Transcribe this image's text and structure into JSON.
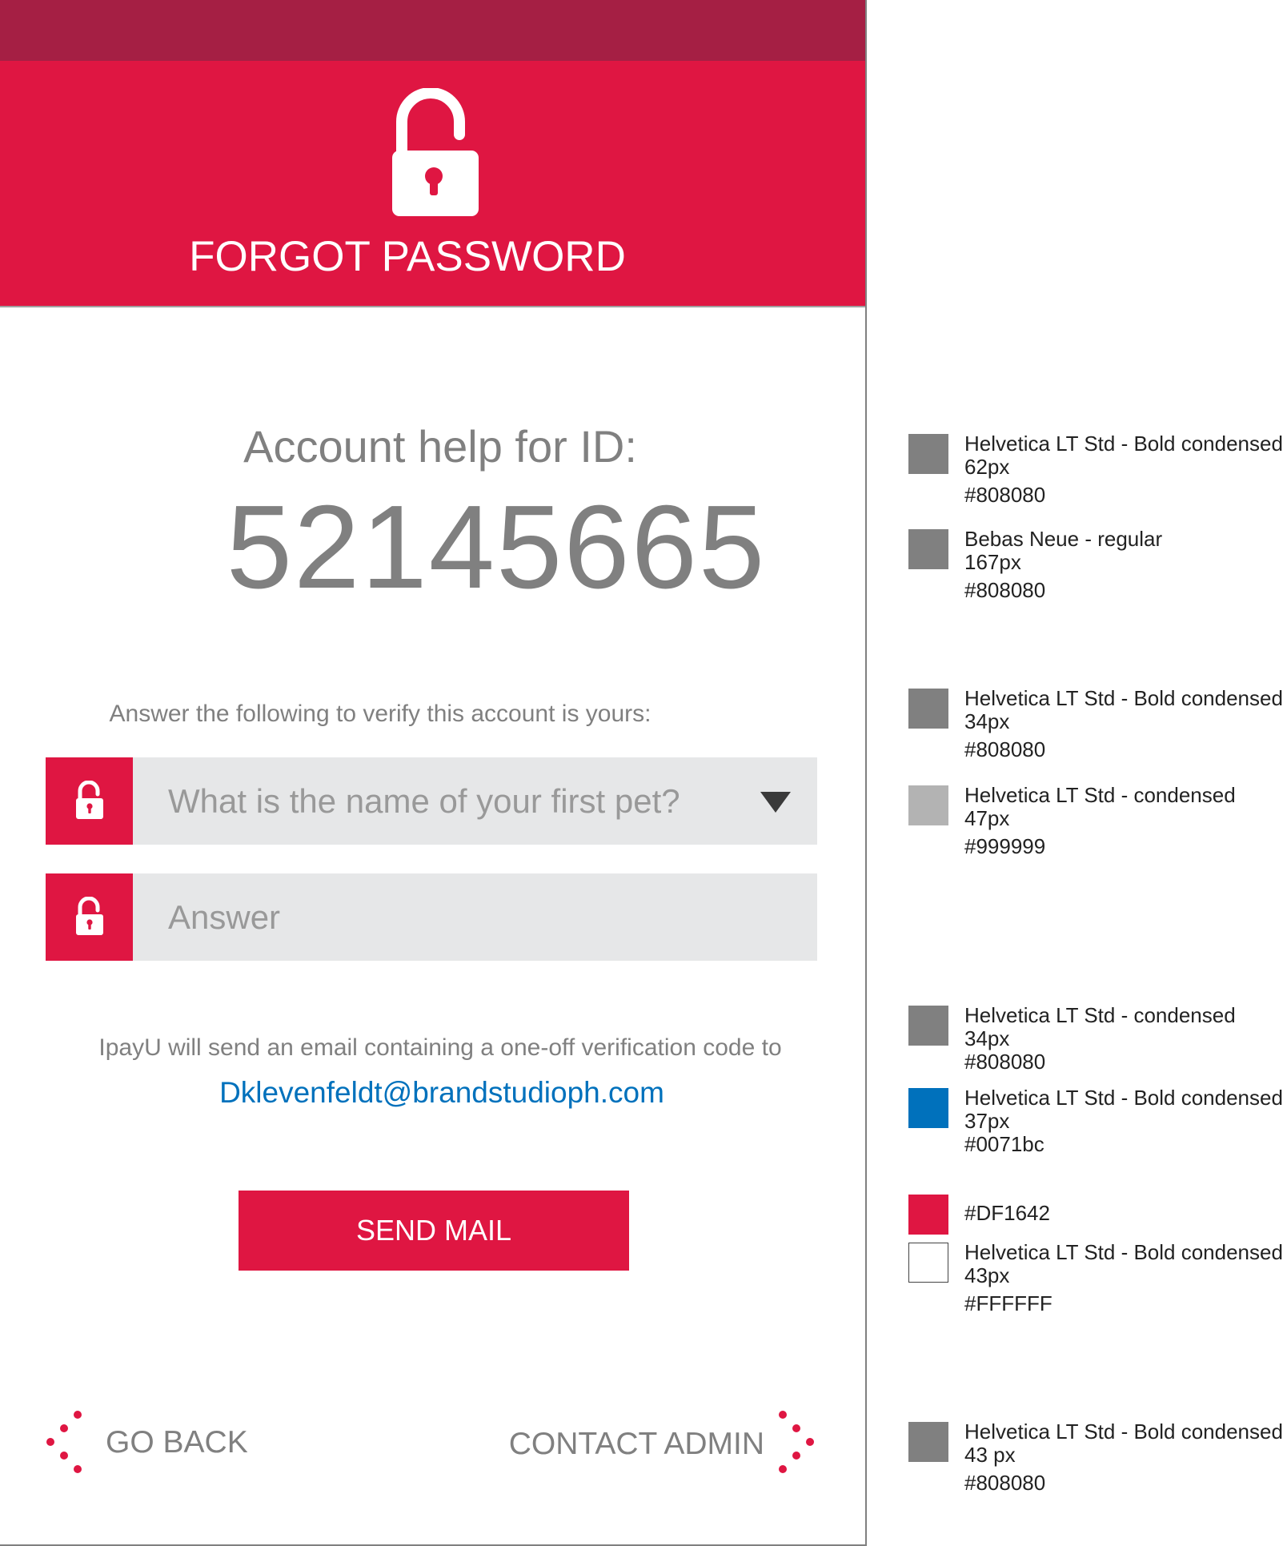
{
  "header": {
    "title": "FORGOT PASSWORD",
    "icon": "unlocked-padlock-icon"
  },
  "account": {
    "label": "Account help for ID:",
    "id": "52145665"
  },
  "form": {
    "instruction": "Answer the following to verify this account is yours:",
    "question": {
      "value": "What is the name of your first pet?",
      "icon": "unlocked-padlock-icon",
      "dropdown_icon": "caret-down-icon"
    },
    "answer": {
      "placeholder": "Answer",
      "icon": "unlocked-padlock-icon"
    }
  },
  "email": {
    "note": "IpayU will send an email containing a one-off verification code to",
    "address": "Dklevenfeldt@brandstudioph.com"
  },
  "actions": {
    "send_label": "SEND MAIL",
    "back_label": "GO BACK",
    "contact_label": "CONTACT ADMIN"
  },
  "colors": {
    "accent": "#DF1642",
    "status_bar": "#A51F44",
    "text_gray": "#808080",
    "placeholder_gray": "#999999",
    "link_blue": "#0071bc",
    "field_bg": "#E6E7E8"
  },
  "specs": [
    {
      "font": "Helvetica LT Std - Bold condensed",
      "size": "62px",
      "color": "#808080"
    },
    {
      "font": "Bebas Neue - regular",
      "size": "167px",
      "color": "#808080"
    },
    {
      "font": "Helvetica LT Std - Bold condensed",
      "size": "34px",
      "color": "#808080"
    },
    {
      "font": "Helvetica LT Std - condensed",
      "size": "47px",
      "color": "#999999"
    },
    {
      "font": "Helvetica LT Std - condensed",
      "size": "34px",
      "color": "#808080"
    },
    {
      "font": "Helvetica LT Std - Bold condensed",
      "size": "37px",
      "color": "#0071bc"
    },
    {
      "font": "",
      "size": "",
      "color": "#DF1642"
    },
    {
      "font": "Helvetica LT Std - Bold condensed",
      "size": "43px",
      "color": "#FFFFFF"
    },
    {
      "font": "Helvetica LT Std - Bold condensed",
      "size": "43 px",
      "color": "#808080"
    }
  ]
}
